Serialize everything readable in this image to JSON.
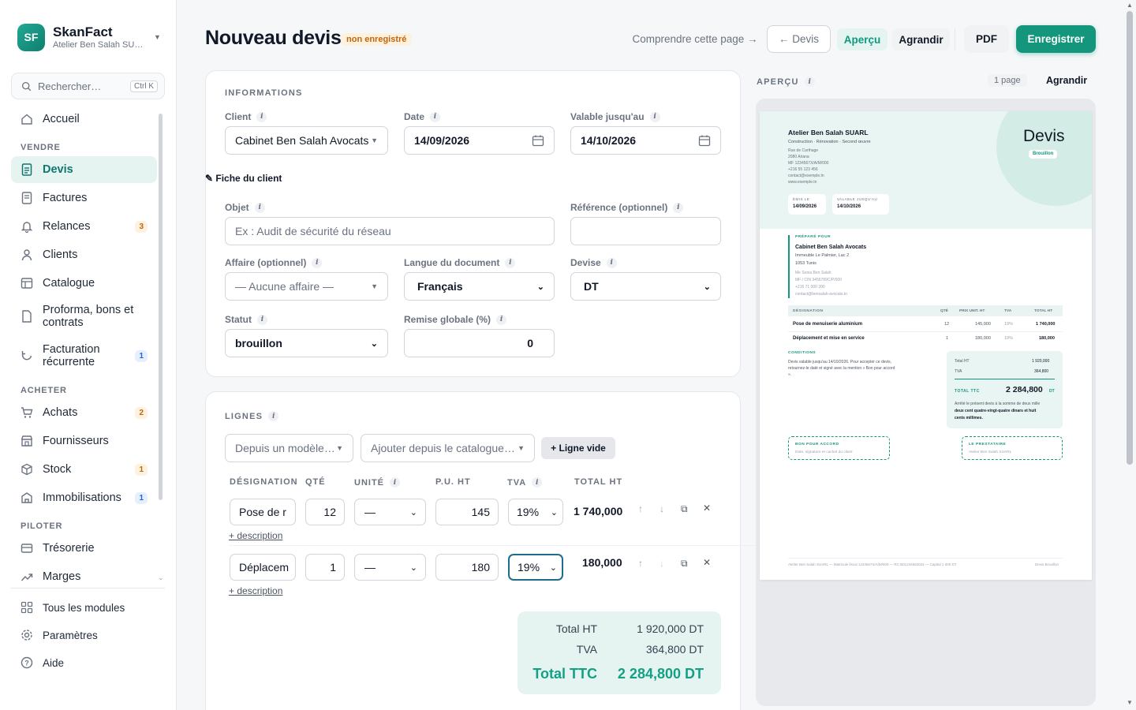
{
  "app": {
    "logo": "SF",
    "name": "SkanFact",
    "company": "Atelier Ben Salah SU…"
  },
  "search": {
    "placeholder": "Rechercher…",
    "shortcut": "Ctrl K"
  },
  "nav": {
    "home": "Accueil",
    "sec_sell": "VENDRE",
    "devis": "Devis",
    "factures": "Factures",
    "relances": "Relances",
    "relances_badge": "3",
    "clients": "Clients",
    "catalogue": "Catalogue",
    "proforma": "Proforma, bons et contrats",
    "recur": "Facturation récurrente",
    "recur_badge": "1",
    "sec_buy": "ACHETER",
    "achats": "Achats",
    "achats_badge": "2",
    "fournisseurs": "Fournisseurs",
    "stock": "Stock",
    "stock_badge": "1",
    "immo": "Immobilisations",
    "immo_badge": "1",
    "sec_steer": "PILOTER",
    "treso": "Trésorerie",
    "marges": "Marges"
  },
  "footer": {
    "modules": "Tous les modules",
    "settings": "Paramètres",
    "help": "Aide"
  },
  "header": {
    "title": "Nouveau devis",
    "status": "non enregistré",
    "understand": "Comprendre cette page →",
    "back": "← Devis",
    "preview": "Aperçu",
    "enlarge": "Agrandir",
    "pdf": "PDF",
    "save": "Enregistrer"
  },
  "info": {
    "section": "INFORMATIONS",
    "client_label": "Client",
    "client_value": "Cabinet Ben Salah Avocats",
    "date_label": "Date",
    "date_value": "14/09/2026",
    "valid_label": "Valable jusqu'au",
    "valid_value": "14/10/2026",
    "fiche": "✎ Fiche du client",
    "objet_label": "Objet",
    "objet_placeholder": "Ex : Audit de sécurité du réseau",
    "ref_label": "Référence (optionnel)",
    "ref_value": "",
    "affaire_label": "Affaire (optionnel)",
    "affaire_value": "— Aucune affaire —",
    "langue_label": "Langue du document",
    "langue_value": "Français",
    "devise_label": "Devise",
    "devise_value": "DT",
    "statut_label": "Statut",
    "statut_value": "brouillon",
    "remise_label": "Remise globale (%)",
    "remise_value": "0"
  },
  "lines": {
    "section": "LIGNES",
    "from_model": "Depuis un modèle…",
    "from_catalog": "Ajouter depuis le catalogue…",
    "empty_line": "+ Ligne vide",
    "cols": {
      "designation": "DÉSIGNATION",
      "qty": "QTÉ",
      "unit": "UNITÉ",
      "pu": "P.U. HT",
      "tva": "TVA",
      "total": "TOTAL HT"
    },
    "rows": [
      {
        "designation": "Pose de r",
        "qty": "12",
        "unit": "—",
        "pu": "145",
        "tva": "19%",
        "total": "1 740,000",
        "desc": "+ description"
      },
      {
        "designation": "Déplacem",
        "qty": "1",
        "unit": "—",
        "pu": "180",
        "tva": "19%",
        "total": "180,000",
        "desc": "+ description"
      }
    ],
    "actions": {
      "up": "↑",
      "down": "↓",
      "copy": "⧉",
      "remove": "✕"
    }
  },
  "totals": {
    "ht_label": "Total HT",
    "ht": "1 920,000 DT",
    "tva_label": "TVA",
    "tva": "364,800 DT",
    "ttc_label": "Total TTC",
    "ttc": "2 284,800 DT"
  },
  "preview": {
    "head": "APERÇU",
    "pages": "1 page",
    "enlarge": "Agrandir",
    "company": "Atelier Ben Salah SUARL",
    "tagline": "Construction · Rénovation · Second œuvre",
    "addr": [
      "Rue de Carthage",
      "2080 Ariana",
      "MF 1234567X/A/M/000",
      "+216 55 123 456",
      "contact@exemple.tn",
      "www.exemple.tn"
    ],
    "doc_title": "Devis",
    "doc_status": "Brouillon",
    "issued_label": "ÉMIS LE",
    "issued": "14/09/2026",
    "valid_label": "VALABLE JUSQU'AU",
    "valid": "14/10/2026",
    "for_label": "PRÉPARÉ POUR",
    "client_name": "Cabinet Ben Salah Avocats",
    "client_addr": [
      "Immeuble Le Palmier, Lac 2",
      "1053 Tunis"
    ],
    "client_extra": [
      "Me Sonia Ben Salah",
      "MF / CIN 3456789C/P/000",
      "+216 71 000 200",
      "contact@bensalah-avocats.tn"
    ],
    "th": {
      "des": "DÉSIGNATION",
      "qty": "QTÉ",
      "pu": "PRIX UNIT. HT",
      "tva": "TVA",
      "tot": "TOTAL HT"
    },
    "rows": [
      {
        "des": "Pose de menuiserie aluminium",
        "qty": "12",
        "pu": "145,000",
        "tva": "19%",
        "tot": "1 740,000"
      },
      {
        "des": "Déplacement et mise en service",
        "qty": "1",
        "pu": "180,000",
        "tva": "19%",
        "tot": "180,000"
      }
    ],
    "cond_label": "CONDITIONS",
    "cond_text": [
      "Devis valable jusqu'au 14/10/2026. Pour accepter ce devis,",
      "retournez-le daté et signé avec la mention « Bon pour accord",
      "»."
    ],
    "tot_ht_label": "Total HT",
    "tot_ht": "1 920,000",
    "tot_tva_label": "TVA",
    "tot_tva": "364,800",
    "tot_ttc_label": "TOTAL TTC",
    "tot_ttc": "2 284,800",
    "tot_cur": "DT",
    "words": [
      "Arrêté le présent devis à la somme de deux mille",
      "deux cent quatre-vingt-quatre dinars et huit",
      "cents millimes."
    ],
    "bpa_label": "BON POUR ACCORD",
    "bpa_sub": "Date, signature et cachet du client",
    "presta_label": "LE PRESTATAIRE",
    "presta_sub": "Atelier Ben Salah SUARL",
    "footer_left": "Atelier Ben Salah SUARL — Matricule fiscal 1234567X/A/M/000 — RC B01234562024 — Capital 1 000 DT",
    "footer_right": "Devis Brouillon"
  }
}
